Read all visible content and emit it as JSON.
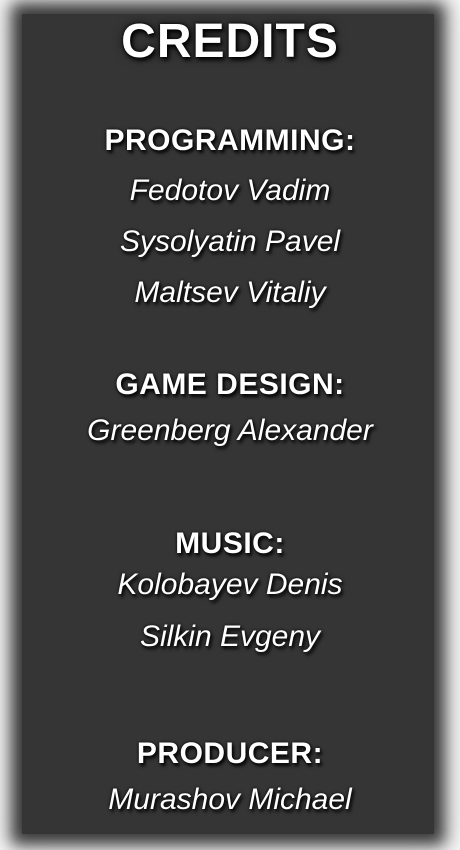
{
  "title": "CREDITS",
  "sections": [
    {
      "heading": "PROGRAMMING:",
      "names": [
        "Fedotov Vadim",
        "Sysolyatin Pavel",
        "Maltsev Vitaliy"
      ]
    },
    {
      "heading": "GAME DESIGN:",
      "names": [
        "Greenberg Alexander"
      ]
    },
    {
      "heading": "MUSIC:",
      "names": [
        "Kolobayev Denis",
        "Silkin Evgeny"
      ]
    },
    {
      "heading": "PRODUCER:",
      "names": [
        "Murashov Michael"
      ]
    }
  ],
  "colors": {
    "panel": "#353535",
    "text": "#ffffff",
    "background": "#ffffff"
  }
}
